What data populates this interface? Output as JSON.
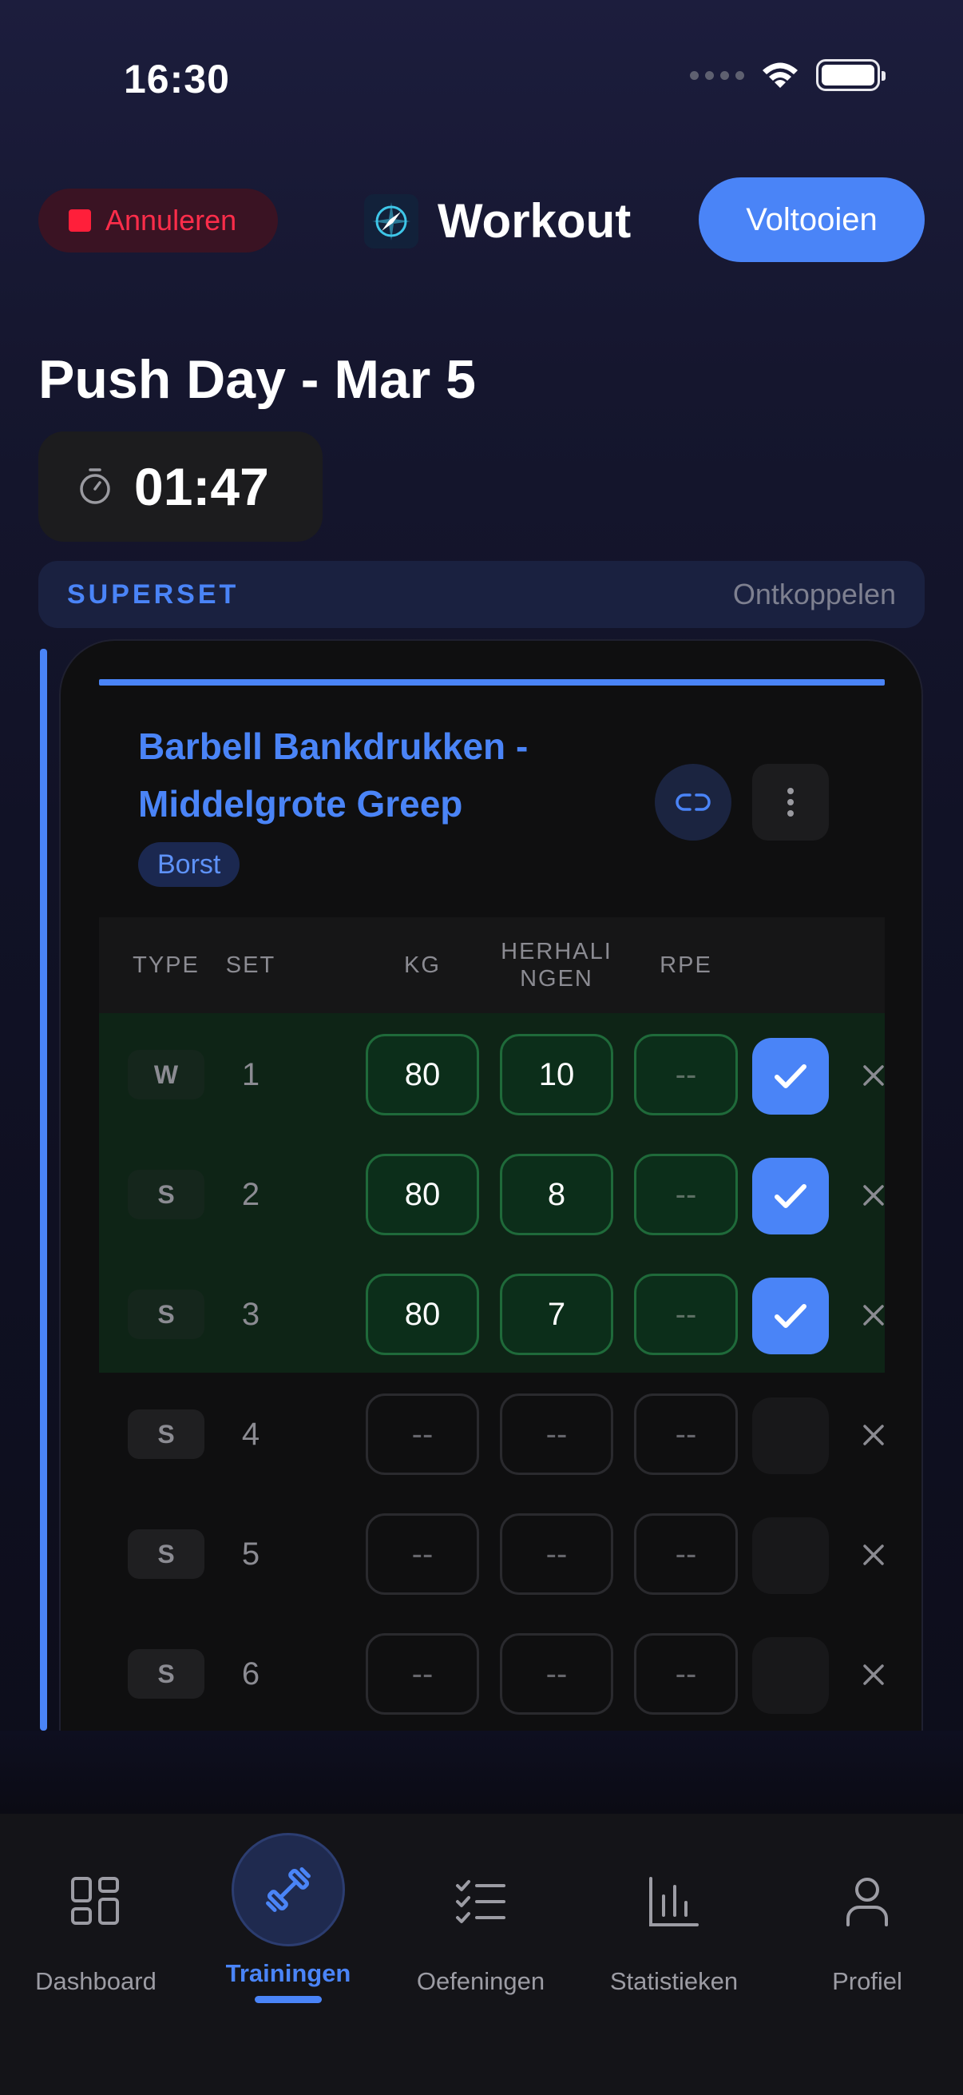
{
  "status_bar": {
    "time": "16:30"
  },
  "header": {
    "cancel_label": "Annuleren",
    "title": "Workout",
    "finish_label": "Voltooien"
  },
  "workout": {
    "title": "Push Day - Mar 5",
    "timer": "01:47"
  },
  "superset": {
    "label": "SUPERSET",
    "unlink_label": "Ontkoppelen"
  },
  "exercise": {
    "name": "Barbell Bankdrukken - Middelgrote Greep",
    "muscle": "Borst",
    "columns": {
      "type": "TYPE",
      "set": "SET",
      "kg": "KG",
      "reps": "HERHALI\nNGEN",
      "rpe": "RPE"
    },
    "sets": [
      {
        "type": "W",
        "set": "1",
        "kg": "80",
        "reps": "10",
        "rpe": "--",
        "completed": true
      },
      {
        "type": "S",
        "set": "2",
        "kg": "80",
        "reps": "8",
        "rpe": "--",
        "completed": true
      },
      {
        "type": "S",
        "set": "3",
        "kg": "80",
        "reps": "7",
        "rpe": "--",
        "completed": true
      },
      {
        "type": "S",
        "set": "4",
        "kg": "--",
        "reps": "--",
        "rpe": "--",
        "completed": false
      },
      {
        "type": "S",
        "set": "5",
        "kg": "--",
        "reps": "--",
        "rpe": "--",
        "completed": false
      },
      {
        "type": "S",
        "set": "6",
        "kg": "--",
        "reps": "--",
        "rpe": "--",
        "completed": false
      }
    ]
  },
  "tabbar": {
    "tabs": [
      {
        "label": "Dashboard",
        "icon": "grid-icon"
      },
      {
        "label": "Trainingen",
        "icon": "dumbbell-icon",
        "active": true
      },
      {
        "label": "Oefeningen",
        "icon": "checklist-icon"
      },
      {
        "label": "Statistieken",
        "icon": "bar-chart-icon"
      },
      {
        "label": "Profiel",
        "icon": "person-icon"
      }
    ]
  },
  "colors": {
    "accent": "#4a84f7",
    "danger": "#ff2d4a",
    "completed_bg": "#0e2416",
    "completed_border": "#1f6a3a"
  }
}
